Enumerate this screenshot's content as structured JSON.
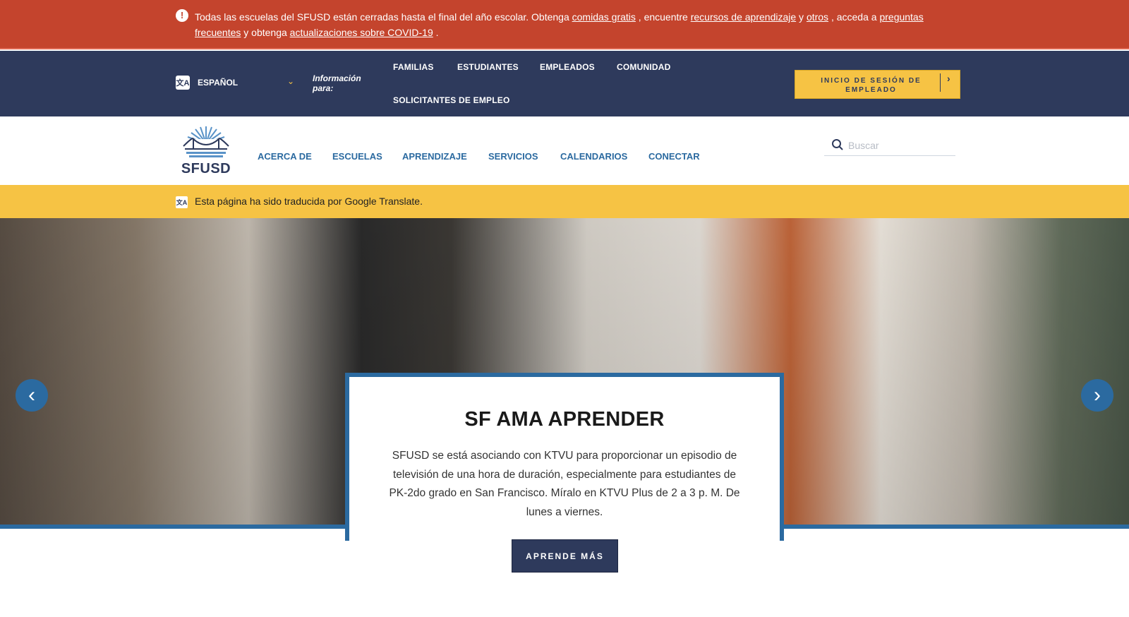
{
  "alert": {
    "text_1": "Todas las escuelas del SFUSD están cerradas hasta el final del año escolar. Obtenga ",
    "link_meals": "comidas gratis",
    "text_2": " , encuentre ",
    "link_resources": "recursos de aprendizaje",
    "text_3": " y ",
    "link_others": "otros",
    "text_4": " , acceda a ",
    "link_faq": "preguntas frecuentes",
    "text_5": " y obtenga ",
    "link_covid": "actualizaciones sobre COVID-19",
    "text_6": " ."
  },
  "topnav": {
    "language": "ESPAÑOL",
    "info_for": "Información para:",
    "audiences": [
      "FAMILIAS",
      "ESTUDIANTES",
      "EMPLEADOS",
      "COMUNIDAD",
      "SOLICITANTES DE EMPLEO"
    ],
    "signin_label": "INICIO DE SESIÓN DE EMPLEADO"
  },
  "header": {
    "logo_text": "SFUSD",
    "nav": [
      "ACERCA DE",
      "ESCUELAS",
      "APRENDIZAJE",
      "SERVICIOS",
      "CALENDARIOS",
      "CONECTAR"
    ],
    "search_placeholder": "Buscar"
  },
  "translate_banner": {
    "text": "Esta página ha sido traducida por Google Translate."
  },
  "hero": {
    "title": "SF AMA APRENDER",
    "description": "SFUSD se está asociando con KTVU para proporcionar un episodio de televisión de una hora de duración, especialmente para estudiantes de PK-2do grado en San Francisco. Míralo en KTVU Plus de 2 a 3 p. M. De lunes a viernes.",
    "cta_label": "APRENDE MÁS"
  },
  "colors": {
    "alert_red": "#c4442d",
    "navy": "#2e3a5c",
    "gold": "#f6c344",
    "link_blue": "#2b6aa0"
  },
  "icons": [
    "alert-icon",
    "translate-icon",
    "chevron-down-icon",
    "chevron-right-icon",
    "search-icon",
    "arrow-left-icon",
    "arrow-right-icon"
  ]
}
